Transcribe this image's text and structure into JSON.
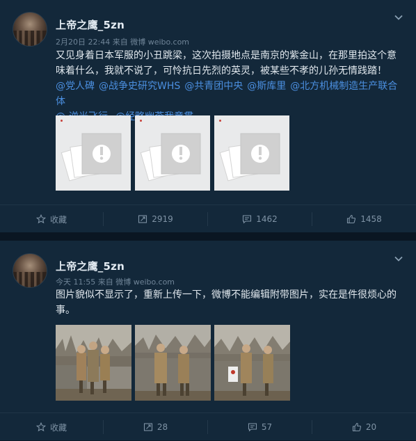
{
  "posts": [
    {
      "username": "上帝之鹰_5zn",
      "time": "2月20日 22:44",
      "via": "来自 微博 weibo.com",
      "text": "又见身着日本军服的小丑跳梁，这次拍摄地点是南京的紫金山，在那里拍这个意味着什么，我就不说了，可怜抗日先烈的英灵，被某些不孝的儿孙无情践踏！",
      "mentions": [
        "@党人碑",
        "@战争史研究WHS",
        "@共青团中央",
        "@斯库里",
        "@北方机械制造生产联合体",
        "@-逆光飞行-",
        "@经略幽燕我童贯"
      ],
      "images": [
        "image-unavailable",
        "image-unavailable",
        "image-unavailable"
      ],
      "actions": {
        "favorite": "收藏",
        "repost": "2919",
        "comment": "1462",
        "like": "1458"
      }
    },
    {
      "username": "上帝之鹰_5zn",
      "time": "今天 11:55",
      "via": "来自 微博 weibo.com",
      "text": "图片貌似不显示了，重新上传一下，微博不能编辑附带图片，实在是件很烦心的事。",
      "images": [
        "photo-cosplay-group-1",
        "photo-cosplay-group-2",
        "photo-cosplay-group-3"
      ],
      "actions": {
        "favorite": "收藏",
        "repost": "28",
        "comment": "57",
        "like": "20"
      }
    }
  ],
  "colors": {
    "background": "#0c1a27",
    "card": "#13283a",
    "mention": "#4b8fe0",
    "muted": "#6f8497"
  },
  "icons": [
    "chevron-down-icon",
    "star-icon",
    "repost-icon",
    "comment-icon",
    "like-icon",
    "broken-image-icon"
  ]
}
